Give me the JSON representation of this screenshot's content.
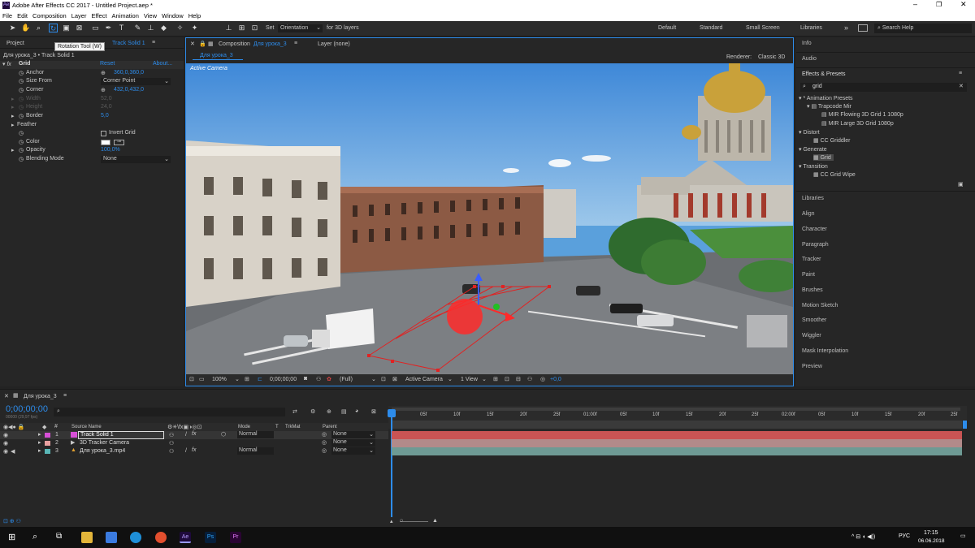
{
  "app": {
    "title": "Adobe After Effects CC 2017 - Untitled Project.aep *"
  },
  "menu": [
    "File",
    "Edit",
    "Composition",
    "Layer",
    "Effect",
    "Animation",
    "View",
    "Window",
    "Help"
  ],
  "toolbar": {
    "set_label": "Set",
    "orientation": "Orientation",
    "for3d": "for 3D layers",
    "tooltip": "Rotation Tool (W)"
  },
  "workspaces": [
    "Default",
    "Standard",
    "Small Screen",
    "Libraries"
  ],
  "search_help": "Search Help",
  "left_panel": {
    "project_tab": "Project",
    "effect_tab": "Track Solid 1",
    "breadcrumb": "Для урока_3 • Track Solid 1",
    "effect_name": "Grid",
    "reset": "Reset",
    "about": "About...",
    "props": [
      {
        "name": "Anchor",
        "value": "360,0,360,0",
        "blue": true
      },
      {
        "name": "Size From",
        "value": "Corner Point",
        "dropdown": true
      },
      {
        "name": "Corner",
        "value": "432,0,432,0",
        "blue": true
      },
      {
        "name": "Width",
        "value": "52,0",
        "dim": true
      },
      {
        "name": "Height",
        "value": "24,0",
        "dim": true
      },
      {
        "name": "Border",
        "value": "5,0",
        "blue": true
      },
      {
        "name": "Feather",
        "value": ""
      },
      {
        "name": "",
        "value": "Invert Grid",
        "checkbox": true
      },
      {
        "name": "Color",
        "value": ""
      },
      {
        "name": "Opacity",
        "value": "100,0%",
        "blue": true
      },
      {
        "name": "Blending Mode",
        "value": "None",
        "dropdown": true
      }
    ]
  },
  "comp": {
    "tab_prefix": "Composition",
    "tab_name": "Для урока_3",
    "layer_tab": "Layer (none)",
    "subtab": "Для урока_3",
    "renderer_label": "Renderer:",
    "renderer": "Classic 3D",
    "active_camera": "Active Camera"
  },
  "viewer_bar": {
    "zoom": "100%",
    "timecode": "0;00;00;00",
    "res": "(Full)",
    "camera": "Active Camera",
    "views": "1 View",
    "exposure": "+0,0"
  },
  "right": {
    "info": "Info",
    "audio": "Audio",
    "effects_presets": "Effects & Presets",
    "search": "grid",
    "tree": [
      {
        "label": "* Animation Presets",
        "indent": 0,
        "arrow": true
      },
      {
        "label": "Trapcode Mir",
        "indent": 1,
        "arrow": true
      },
      {
        "label": "MIR Flowing 3D Grid 1 1080p",
        "indent": 2
      },
      {
        "label": "MIR Large 3D Grid 1080p",
        "indent": 2
      },
      {
        "label": "Distort",
        "indent": 0,
        "arrow": true
      },
      {
        "label": "CC Griddler",
        "indent": 1
      },
      {
        "label": "Generate",
        "indent": 0,
        "arrow": true
      },
      {
        "label": "Grid",
        "indent": 1,
        "selected": true
      },
      {
        "label": "Transition",
        "indent": 0,
        "arrow": true
      },
      {
        "label": "CC Grid Wipe",
        "indent": 1
      }
    ],
    "panels": [
      "Libraries",
      "Align",
      "Character",
      "Paragraph",
      "Tracker",
      "Paint",
      "Brushes",
      "Motion Sketch",
      "Smoother",
      "Wiggler",
      "Mask Interpolation",
      "Preview"
    ]
  },
  "timeline": {
    "tab": "Для урока_3",
    "timecode": "0;00;00;00",
    "fps": "00000 (29,97 fps)",
    "headers": {
      "source": "Source Name",
      "mode": "Mode",
      "t": "T",
      "trkmat": "TrkMat",
      "parent": "Parent"
    },
    "layers": [
      {
        "num": "1",
        "name": "Track Solid 1",
        "color": "#d64fd6",
        "mode": "Normal",
        "parent": "None",
        "bar": "#c95454"
      },
      {
        "num": "2",
        "name": "3D Tracker Camera",
        "color": "#e8a0a0",
        "mode": "",
        "parent": "None",
        "bar": "#b28a8a"
      },
      {
        "num": "3",
        "name": "Для урока_3.mp4",
        "color": "#59b6b6",
        "mode": "Normal",
        "parent": "None",
        "bar": "#6e9a94"
      }
    ],
    "ruler": [
      "00f",
      "05f",
      "10f",
      "15f",
      "20f",
      "25f",
      "01:00f",
      "05f",
      "10f",
      "15f",
      "20f",
      "25f",
      "02:00f",
      "05f",
      "10f",
      "15f",
      "20f",
      "25f"
    ]
  },
  "taskbar": {
    "time": "17:15",
    "date": "06.06.2018",
    "lang": "РУС"
  }
}
